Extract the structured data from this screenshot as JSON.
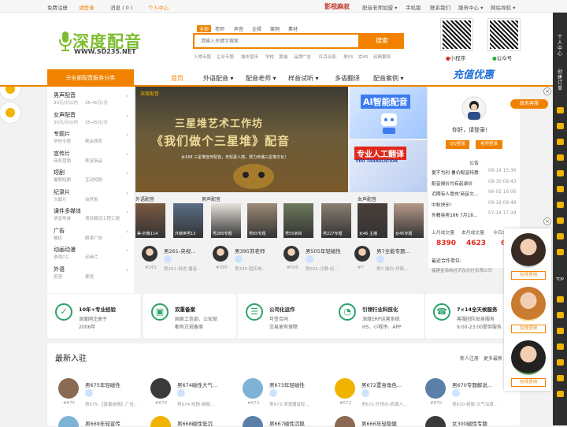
{
  "topbar": {
    "register": "免费注册",
    "login": "请登录",
    "messages": "消息 ( 0 )",
    "personal": "个人中心",
    "brand_slogan": "影视麻叔",
    "teacher_join": "配音老师加盟 ▾",
    "mobile": "手机版",
    "contact": "联系我们",
    "service_center": "服务中心 ▾",
    "site_nav": "网站导航 ▾"
  },
  "right_rail": {
    "center": "个人中心",
    "order": "创建订单",
    "top": "TOP"
  },
  "logo": {
    "title": "深度配音",
    "url": "WWW.SD235.NET"
  },
  "search": {
    "tabs": [
      "全部",
      "老师",
      "声音",
      "企规",
      "案例",
      "素材"
    ],
    "active_tab": "全部",
    "placeholder": "请输入关键字搜索",
    "button": "搜索",
    "hot_words": [
      "人物专题",
      "企业专题",
      "城市宣传",
      "学校",
      "黄埔",
      "品牌广告",
      "红目合影",
      "男55",
      "女45",
      "经典案例"
    ]
  },
  "qr": {
    "mini_program": "小程序",
    "official_account": "公众号"
  },
  "nav": {
    "category_btn": "☰全部配音服务分类",
    "items": [
      "首页",
      "外语配音 ▾",
      "配音老师 ▾",
      "样音试听 ▾",
      "多语翻译",
      "配音案例 ▾"
    ],
    "recharge": "充值优惠"
  },
  "sidebar": [
    {
      "cat": "男声配音",
      "subs": [
        "30元/分以内",
        "35-40元/分"
      ]
    },
    {
      "cat": "女声配音",
      "subs": [
        "30元/分以内",
        "35-45元/分"
      ]
    },
    {
      "cat": "专题片",
      "subs": [
        "学校专题",
        "晚会颁奖"
      ]
    },
    {
      "cat": "宣传片",
      "subs": [
        "商务营销",
        "珠宝新品"
      ]
    },
    {
      "cat": "短剧",
      "subs": [
        "暑期短剧",
        "互动短剧"
      ]
    },
    {
      "cat": "纪录片",
      "subs": [
        "文献片",
        "自然类"
      ]
    },
    {
      "cat": "课件多媒体",
      "subs": [
        "语音导游",
        "项目解说工程汇报"
      ]
    },
    {
      "cat": "广告",
      "subs": [
        "楼纺",
        "眼罩广告"
      ]
    },
    {
      "cat": "动画动漫",
      "subs": [
        "游戏CG",
        "动画片"
      ]
    },
    {
      "cat": "外语",
      "subs": [
        "英语",
        "泰语"
      ]
    }
  ],
  "banner": {
    "logo": "深度配音",
    "line1": "三星堆艺术工作坊",
    "line2": "《我们做个三星堆》配音",
    "sub": "女168 三星堆宣传配音，年轻素人感，努力传播三星堆文化！",
    "ai_title": "AI智能配音",
    "trans_title": "专业人工翻译",
    "trans_en": "PRO TRANSLATION"
  },
  "user": {
    "greeting": "你好，请登录！",
    "qq_login": "QQ登录",
    "teacher_register": "老师登录"
  },
  "notice": {
    "title": "公告",
    "items": [
      {
        "t": "夏不为利 暑价配音特惠",
        "d": "08-14 15:36"
      },
      {
        "t": "配音报价均有起录价",
        "d": "08-30 09:43"
      },
      {
        "t": "近期有人冒充'商音文...",
        "d": "06-02 16:06"
      },
      {
        "t": "中秋快乐！",
        "d": "09-19 09:48"
      },
      {
        "t": "外籍英男186 7月18...",
        "d": "07-14 17:39"
      }
    ]
  },
  "stats": {
    "labels": [
      "上月成交量",
      "本月成交量",
      "今日成"
    ],
    "values": [
      "8390",
      "4623",
      "6"
    ],
    "partner_label": "最近合作单位:",
    "partner": "福建金海峡经济杂志社有限公司"
  },
  "sections": {
    "foreign": "外语配音",
    "male": "男声配音",
    "female": "女声配音"
  },
  "thumbs": [
    "美-外籍114",
    "外籍英男13",
    "男280专题",
    "男65专题",
    "男55亲和",
    "男227专题",
    "女46 主播",
    "女45专题"
  ],
  "teachers": [
    {
      "name": "男261-央视...",
      "no": "#261",
      "sub": "男261-讲述-播音..."
    },
    {
      "name": "男395苏老师",
      "no": "#395",
      "sub": "男395-国庆电..."
    },
    {
      "name": "男505年轻磁性",
      "no": "#505",
      "sub": "男505-冷静-纪..."
    },
    {
      "name": "男7全能专题...",
      "no": "#7",
      "sub": "男7-独白-抒情..."
    }
  ],
  "features": [
    {
      "t": "10年+专业经验",
      "d": [
        "深度网注册于",
        "2006年"
      ]
    },
    {
      "t": "双重备案",
      "d": [
        "国家工信部、公安部",
        "都有正规备案"
      ]
    },
    {
      "t": "公司化运作",
      "d": [
        "可签合同",
        "交易更有保障"
      ]
    },
    {
      "t": "引领行业科技化",
      "d": [
        "深度ERP运营系统",
        "H5、小程序、APP"
      ]
    },
    {
      "t": "7×14全天候服务",
      "d": [
        "客服团队贴身服务",
        "9:00-23:00提供服务"
      ]
    }
  ],
  "new_join": {
    "title": "最新入驻",
    "register": "新人注册",
    "more": "更多最新 ▸",
    "cards": [
      {
        "name": "男675年轻磁性",
        "no": "#675",
        "sub": "男675-【香番遍情】广告..."
      },
      {
        "name": "男674磁性大气...",
        "no": "#674",
        "sub": "男674-短剧-悬疑..."
      },
      {
        "name": "男673年轻磁性",
        "no": "#673",
        "sub": "男673-浪漫播音腔..."
      },
      {
        "name": "男672置身角色...",
        "no": "#672",
        "sub": "男672-开场白-机器人..."
      },
      {
        "name": "男670专题解说...",
        "no": "#670",
        "sub": "男670-极致-大气深厚..."
      }
    ],
    "row2": [
      "男669年轻宣传",
      "男668磁性低沉",
      "男667磁性沉稳",
      "男666年轻稳健",
      "女300磁性专题"
    ]
  },
  "float": {
    "consult": [
      "在线咨询",
      "在线咨询",
      "在线咨询"
    ],
    "kefu": "联系客服"
  },
  "colors": {
    "accent": "#f08200",
    "logo_green": "#7cbd2f",
    "price_red": "#e0281a"
  }
}
